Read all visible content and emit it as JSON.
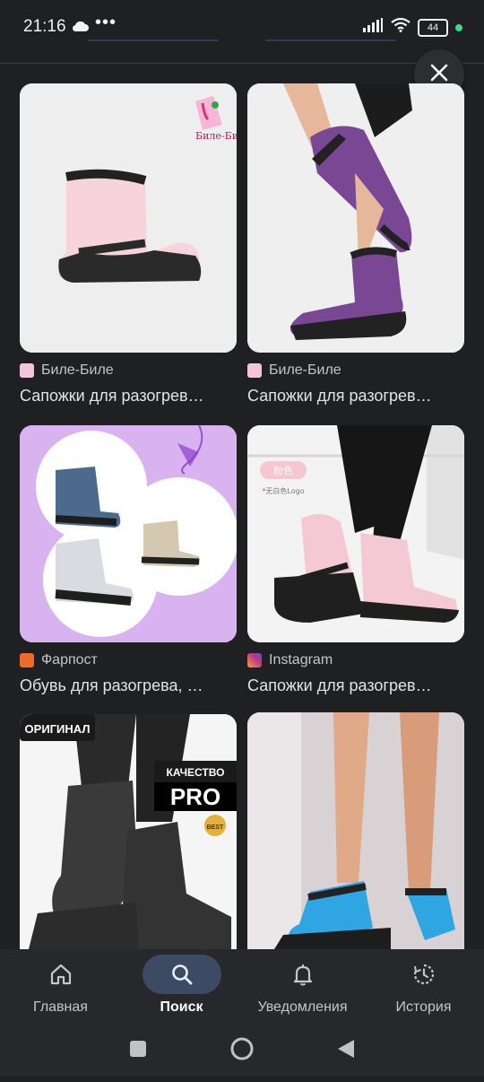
{
  "status_bar": {
    "time": "21:16",
    "dots": "•••",
    "battery": "44"
  },
  "results": [
    {
      "source": "Биле-Биле",
      "title": "Сапожки для разогрев…",
      "favicon_color": "#f3c5dc",
      "image_text": "Биле-Биле"
    },
    {
      "source": "Биле-Биле",
      "title": "Сапожки для разогрев…",
      "favicon_color": "#f3c5dc"
    },
    {
      "source": "Фарпост",
      "title": "Обувь для разогрева, …",
      "favicon_color": "#ef6a2a"
    },
    {
      "source": "Instagram",
      "title": "Сапожки для разогрев…",
      "favicon_color": "#c13584",
      "image_text": "粉色",
      "image_subtext": "*无白色Logo"
    },
    {
      "badge1": "ОРИГИНАЛ",
      "badge2": "КАЧЕСТВО",
      "badge3": "PRO",
      "badge4": "BEST"
    },
    {}
  ],
  "bottom_nav": {
    "items": [
      {
        "label": "Главная",
        "icon": "home-icon",
        "active": false
      },
      {
        "label": "Поиск",
        "icon": "search-icon",
        "active": true
      },
      {
        "label": "Уведомления",
        "icon": "bell-icon",
        "active": false
      },
      {
        "label": "История",
        "icon": "history-icon",
        "active": false
      }
    ]
  },
  "colors": {
    "background": "#1f2022",
    "nav_active": "#3c4a63",
    "text": "#e3e3e3"
  }
}
